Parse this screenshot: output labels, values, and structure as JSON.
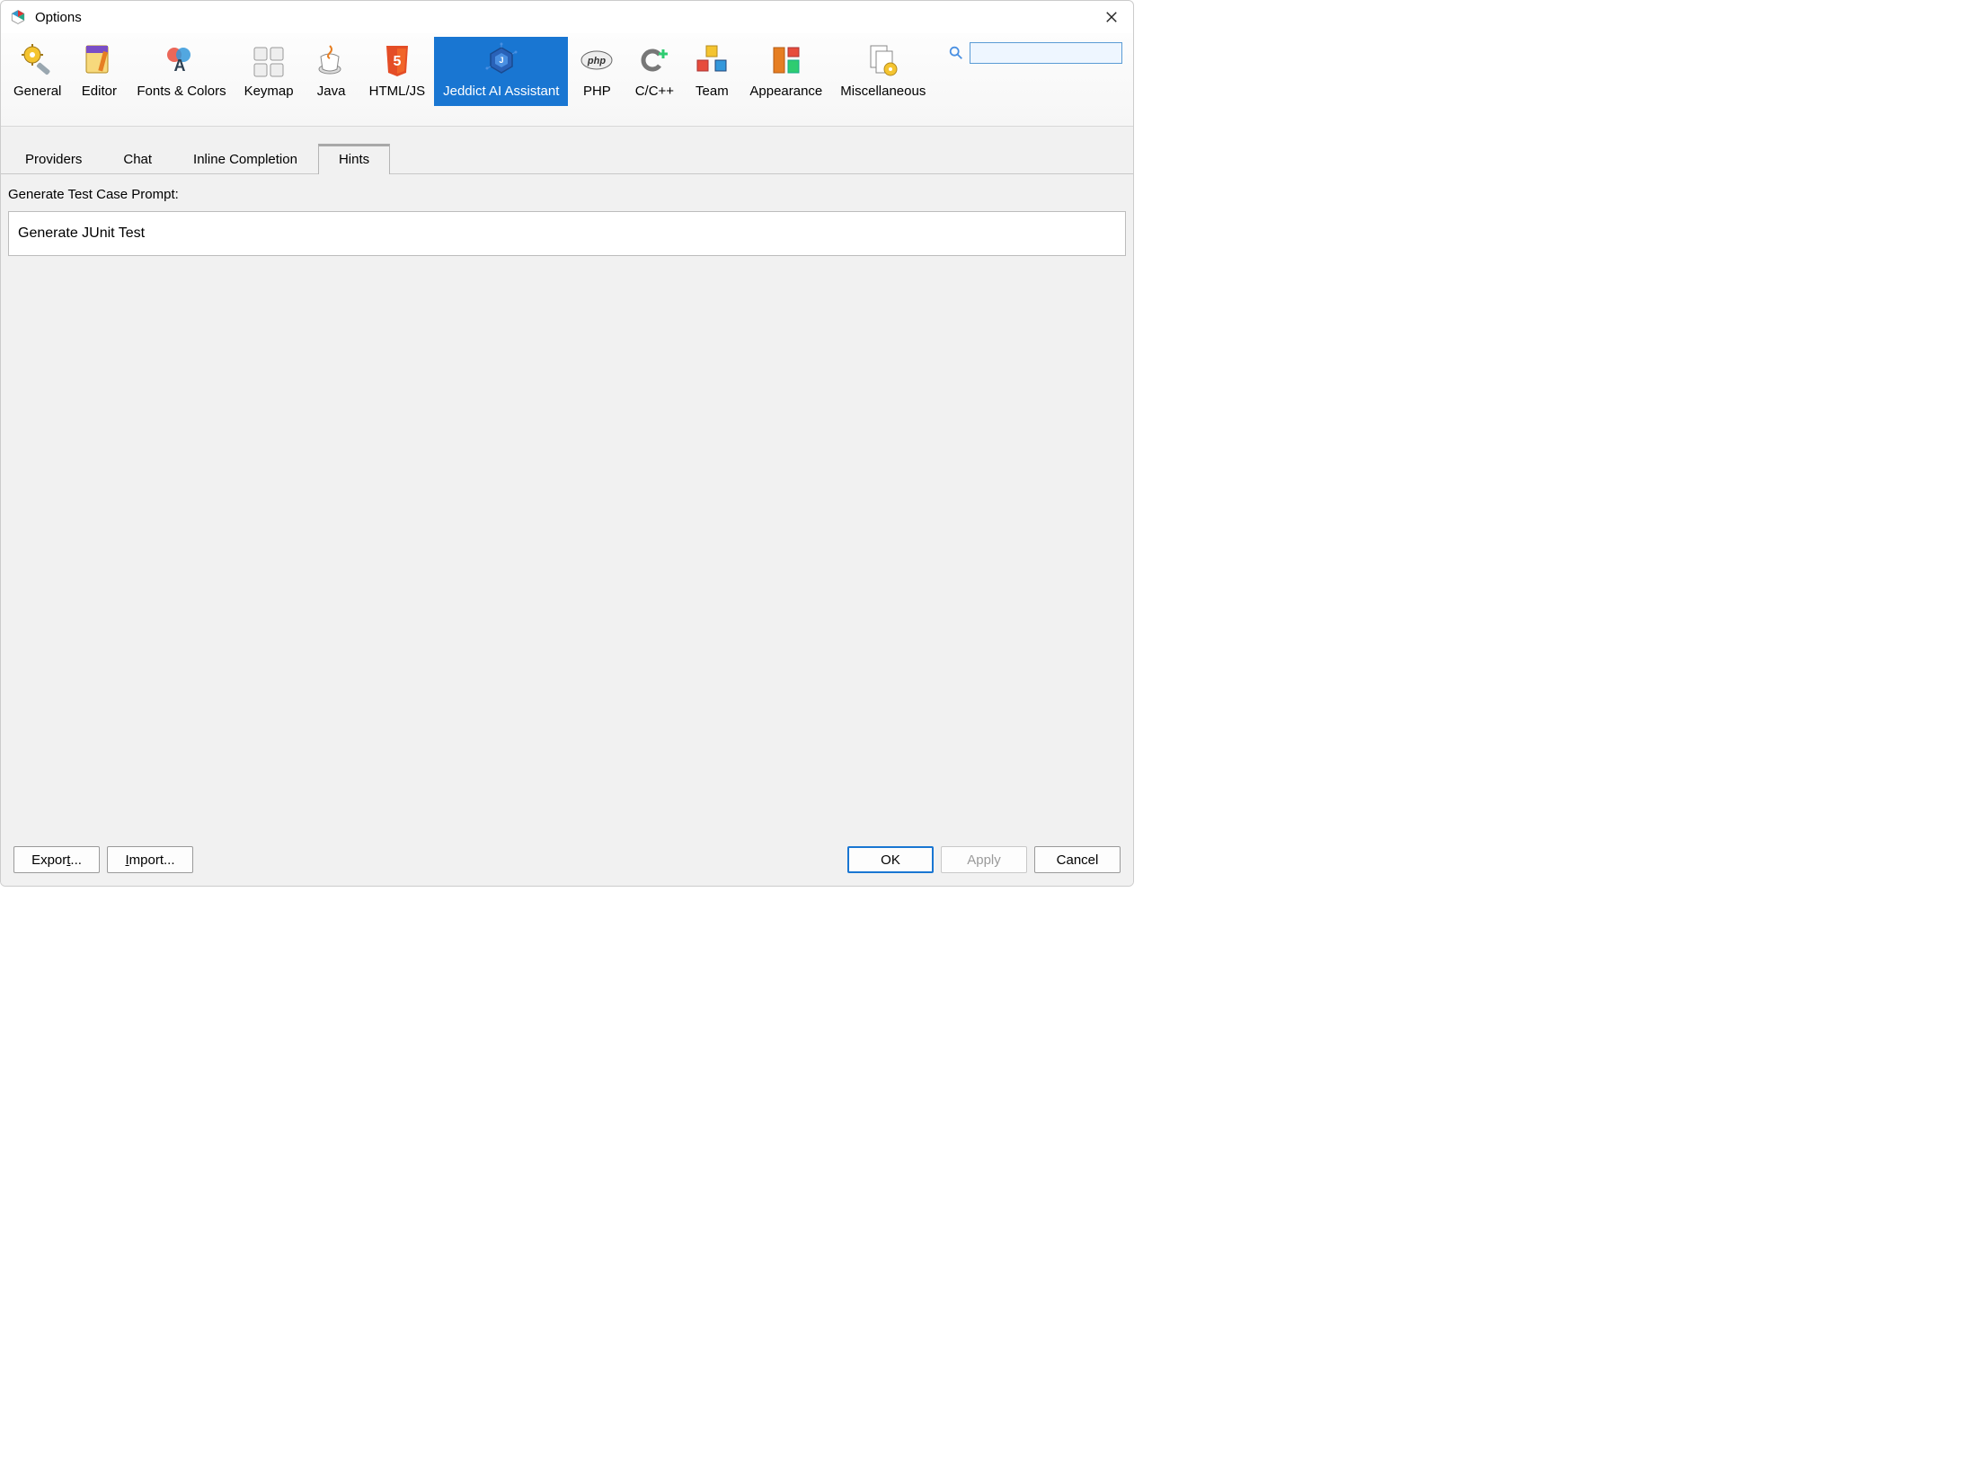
{
  "window": {
    "title": "Options"
  },
  "toolbar": {
    "categories": [
      {
        "id": "general",
        "label": "General"
      },
      {
        "id": "editor",
        "label": "Editor"
      },
      {
        "id": "fonts-colors",
        "label": "Fonts & Colors"
      },
      {
        "id": "keymap",
        "label": "Keymap"
      },
      {
        "id": "java",
        "label": "Java"
      },
      {
        "id": "html-js",
        "label": "HTML/JS"
      },
      {
        "id": "jeddict-ai",
        "label": "Jeddict AI Assistant",
        "selected": true
      },
      {
        "id": "php",
        "label": "PHP"
      },
      {
        "id": "c-cpp",
        "label": "C/C++"
      },
      {
        "id": "team",
        "label": "Team"
      },
      {
        "id": "appearance",
        "label": "Appearance"
      },
      {
        "id": "misc",
        "label": "Miscellaneous"
      }
    ],
    "search_value": ""
  },
  "tabs": {
    "items": [
      {
        "label": "Providers"
      },
      {
        "label": "Chat"
      },
      {
        "label": "Inline Completion"
      },
      {
        "label": "Hints",
        "active": true
      }
    ]
  },
  "form": {
    "prompt_label": "Generate Test Case Prompt:",
    "prompt_value": "Generate JUnit Test"
  },
  "footer": {
    "export": "Export...",
    "import": "Import...",
    "ok": "OK",
    "apply": "Apply",
    "cancel": "Cancel"
  }
}
